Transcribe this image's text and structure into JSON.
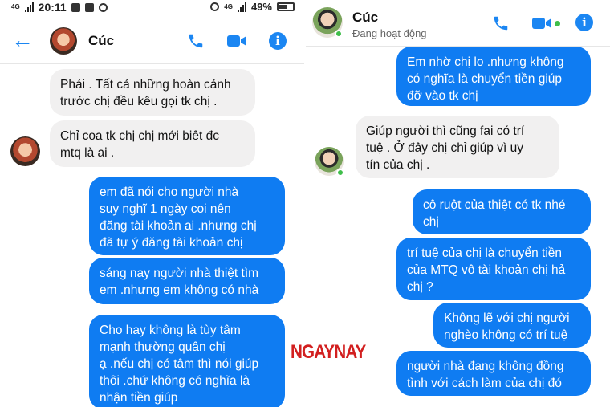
{
  "left": {
    "status_bar": {
      "network": "4G",
      "time": "20:11",
      "network_right": "4G",
      "battery": "49%"
    },
    "header": {
      "back_icon": "arrow-left-icon",
      "contact_name": "Cúc",
      "icons": [
        "phone-icon",
        "video-camera-icon",
        "info-icon"
      ]
    },
    "messages": [
      {
        "side": "received",
        "text": "Phải . Tất cả những hoàn cảnh\ntrước chị đều kêu gọi tk chị ."
      },
      {
        "side": "received",
        "text": "Chỉ coa tk chị chị mới biêt đc\nmtq là ai ."
      },
      {
        "side": "sent",
        "text": "em đã nói cho người nhà\nsuy nghĩ 1 ngày coi nên\nđăng tài khoản ai .nhưng chị\nđã tự ý đăng tài khoản chị"
      },
      {
        "side": "sent",
        "text": "sáng nay người nhà thiệt tìm\nem .nhưng em không có nhà"
      },
      {
        "side": "sent",
        "text": "Cho hay không là tùy tâm\nmạnh thường quân chị\nạ .nếu chị có tâm thì nói giúp\nthôi .chứ không có nghĩa là\nnhận tiền giúp"
      }
    ]
  },
  "right": {
    "header": {
      "contact_name": "Cúc",
      "status": "Đang hoạt động",
      "icons": [
        "phone-icon",
        "video-camera-icon",
        "info-icon"
      ]
    },
    "messages": [
      {
        "side": "sent",
        "text": "Em nhờ chị lo .nhưng không\ncó nghĩa là chuyển tiền giúp\nđỡ vào tk chị"
      },
      {
        "side": "received",
        "text": "Giúp người thì cũng fai có trí\ntuệ . Ở đây chị chỉ giúp vì uy\ntín của chị ."
      },
      {
        "side": "sent",
        "text": "cô ruột của thiệt có tk nhé\nchị"
      },
      {
        "side": "sent",
        "text": "trí tuệ của chị là chuyển tiền\ncủa MTQ vô tài khoản chị hả\nchị ?"
      },
      {
        "side": "sent",
        "text": "Không lẽ với chị  người\nnghèo không có trí tuệ"
      },
      {
        "side": "sent",
        "text": "người nhà đang không đồng\ntình với cách làm của chị đó"
      }
    ]
  },
  "watermark": "NGAYNAY",
  "colors": {
    "sent_bubble": "#0f7cf2",
    "received_bubble": "#f1f0f0",
    "accent": "#1b86f2",
    "online": "#3fbe4a",
    "watermark": "#d21f1f"
  }
}
